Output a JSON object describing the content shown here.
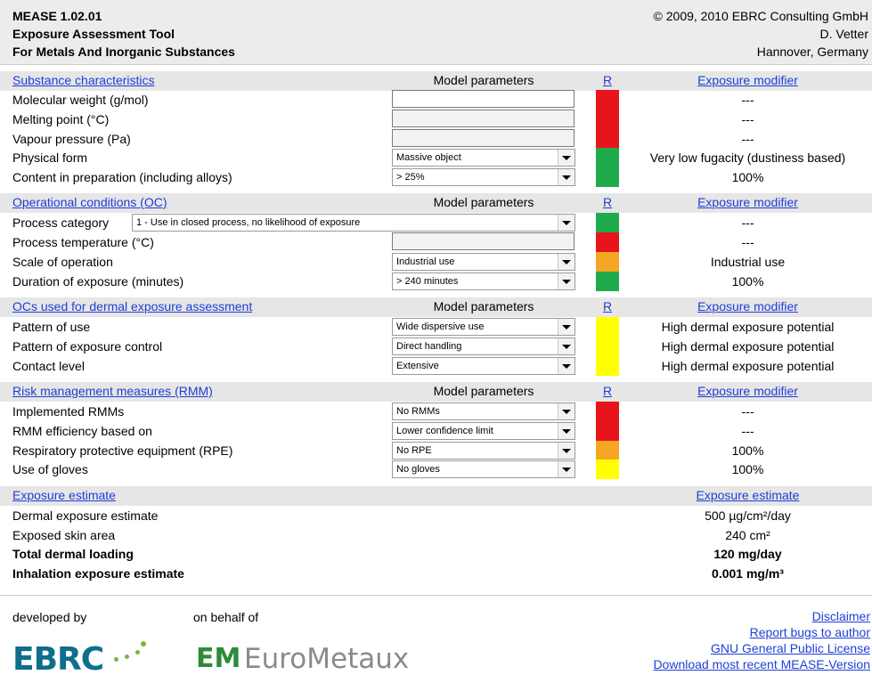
{
  "header": {
    "app_name": "MEASE 1.02.01",
    "subtitle": "Exposure Assessment Tool",
    "scope": "For Metals And Inorganic Substances",
    "copyright": "© 2009, 2010 EBRC Consulting GmbH",
    "author": "D. Vetter",
    "location": "Hannover, Germany"
  },
  "columns": {
    "model_parameters": "Model parameters",
    "r": "R",
    "exposure_modifier": "Exposure modifier"
  },
  "colors": {
    "red": "#e8141b",
    "green": "#1faa4b",
    "orange": "#f5a623",
    "yellow": "#ffff00",
    "link": "#1f3ed6"
  },
  "substance": {
    "title": "Substance characteristics",
    "rows": [
      {
        "label": "Molecular weight (g/mol)",
        "r": "red",
        "modifier": "---"
      },
      {
        "label": "Melting point (°C)",
        "r": "red",
        "modifier": "---"
      },
      {
        "label": "Vapour pressure (Pa)",
        "r": "red",
        "modifier": "---"
      },
      {
        "label": "Physical form",
        "value": "Massive object",
        "r": "green",
        "modifier": "Very low fugacity (dustiness based)"
      },
      {
        "label": "Content in preparation (including alloys)",
        "value": "> 25%",
        "r": "green",
        "modifier": "100%"
      }
    ]
  },
  "operational": {
    "title": "Operational conditions (OC)",
    "rows": [
      {
        "label": "Process category",
        "value": "1 - Use in closed process, no likelihood of exposure",
        "r": "green",
        "modifier": "---"
      },
      {
        "label": "Process temperature (°C)",
        "r": "red",
        "modifier": "---"
      },
      {
        "label": "Scale of operation",
        "value": "Industrial use",
        "r": "orange",
        "modifier": "Industrial use"
      },
      {
        "label": "Duration of exposure (minutes)",
        "value": "> 240 minutes",
        "r": "green",
        "modifier": "100%"
      }
    ]
  },
  "dermal": {
    "title": "OCs used for dermal exposure assessment",
    "rows": [
      {
        "label": "Pattern of use",
        "value": "Wide dispersive use",
        "r": "yellow",
        "modifier": "High dermal exposure potential"
      },
      {
        "label": "Pattern of exposure control",
        "value": "Direct handling",
        "r": "yellow",
        "modifier": "High dermal exposure potential"
      },
      {
        "label": "Contact level",
        "value": "Extensive",
        "r": "yellow",
        "modifier": "High dermal exposure potential"
      }
    ]
  },
  "rmm": {
    "title": "Risk management measures (RMM)",
    "rows": [
      {
        "label": "Implemented RMMs",
        "value": "No RMMs",
        "r": "red",
        "modifier": "---"
      },
      {
        "label": "RMM efficiency based on",
        "value": "Lower confidence limit",
        "r": "red",
        "modifier": "---"
      },
      {
        "label": "Respiratory protective equipment (RPE)",
        "value": "No RPE",
        "r": "orange",
        "modifier": "100%"
      },
      {
        "label": "Use of gloves",
        "value": "No gloves",
        "r": "yellow",
        "modifier": "100%"
      }
    ]
  },
  "estimate": {
    "title": "Exposure estimate",
    "column": "Exposure estimate",
    "rows": [
      {
        "label": "Dermal exposure estimate",
        "value": "500 µg/cm²/day"
      },
      {
        "label": "Exposed skin area",
        "value": "240 cm²"
      },
      {
        "label": "Total dermal loading",
        "value": "120 mg/day"
      },
      {
        "label": "Inhalation exposure estimate",
        "value": "0.001 mg/m³"
      }
    ]
  },
  "footer": {
    "developed_by": "developed by",
    "on_behalf_of": "on behalf of",
    "ebrc_logo": "EBRC",
    "eurometaux_mark": "EM",
    "eurometaux_logo": "EuroMetaux",
    "links": [
      "Disclaimer",
      "Report bugs to author",
      "GNU General Public License",
      "Download most recent MEASE-Version"
    ]
  }
}
